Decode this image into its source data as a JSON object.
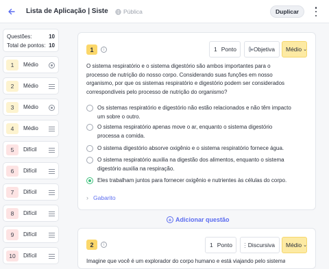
{
  "header": {
    "title": "Lista de Aplicação | Sistem...",
    "visibility": "Pública",
    "duplicate_label": "Duplicar"
  },
  "sidebar": {
    "questions_label": "Questões:",
    "questions_count": "10",
    "points_label": "Total de pontos:",
    "points_count": "10",
    "items": [
      {
        "num": "1",
        "label": "Médio",
        "icon": "radio-icon"
      },
      {
        "num": "2",
        "label": "Médio",
        "icon": "lines-icon"
      },
      {
        "num": "3",
        "label": "Médio",
        "icon": "radio-icon"
      },
      {
        "num": "4",
        "label": "Médio",
        "icon": "lines-icon"
      },
      {
        "num": "5",
        "label": "Difícil",
        "icon": "lines-icon"
      },
      {
        "num": "6",
        "label": "Difícil",
        "icon": "lines-icon"
      },
      {
        "num": "7",
        "label": "Difícil",
        "icon": "lines-icon"
      },
      {
        "num": "8",
        "label": "Difícil",
        "icon": "lines-icon"
      },
      {
        "num": "9",
        "label": "Difícil",
        "icon": "lines-icon"
      },
      {
        "num": "10",
        "label": "Difícil",
        "icon": "lines-icon"
      }
    ]
  },
  "question1": {
    "number": "1",
    "points_value": "1",
    "points_label": "Ponto",
    "type": "Objetiva",
    "difficulty": "Médio",
    "stem": "O sistema respiratório e o sistema digestório são ambos importantes para o processo de nutrição do nosso corpo. Considerando suas funções em nosso organismo, por que os sistemas respiratório e digestório podem ser considerados correspondíveis pelo processo de nutrição do organismo?",
    "options": [
      "Os sistemas respiratório e digestório não estão relacionados e não têm impacto um sobre o outro.",
      "O sistema respiratório apenas move o ar, enquanto o sistema digestório processa a comida.",
      "O sistema digestório absorve oxigênio e o sistema respiratório fornece água.",
      "O sistema respiratório auxilia na digestão dos alimentos, enquanto o sistema digestório auxilia na respiração.",
      "Eles trabalham juntos para fornecer oxigênio e nutrientes às células do corpo."
    ],
    "answer_label": "Gabarito"
  },
  "add_question_label": "Adicionar questão",
  "question2": {
    "number": "2",
    "points_value": "1",
    "points_label": "Ponto",
    "type": "Discursiva",
    "difficulty": "Médio",
    "stem": "Imagine que você é um explorador do corpo humano e está viajando pelo sistema"
  }
}
